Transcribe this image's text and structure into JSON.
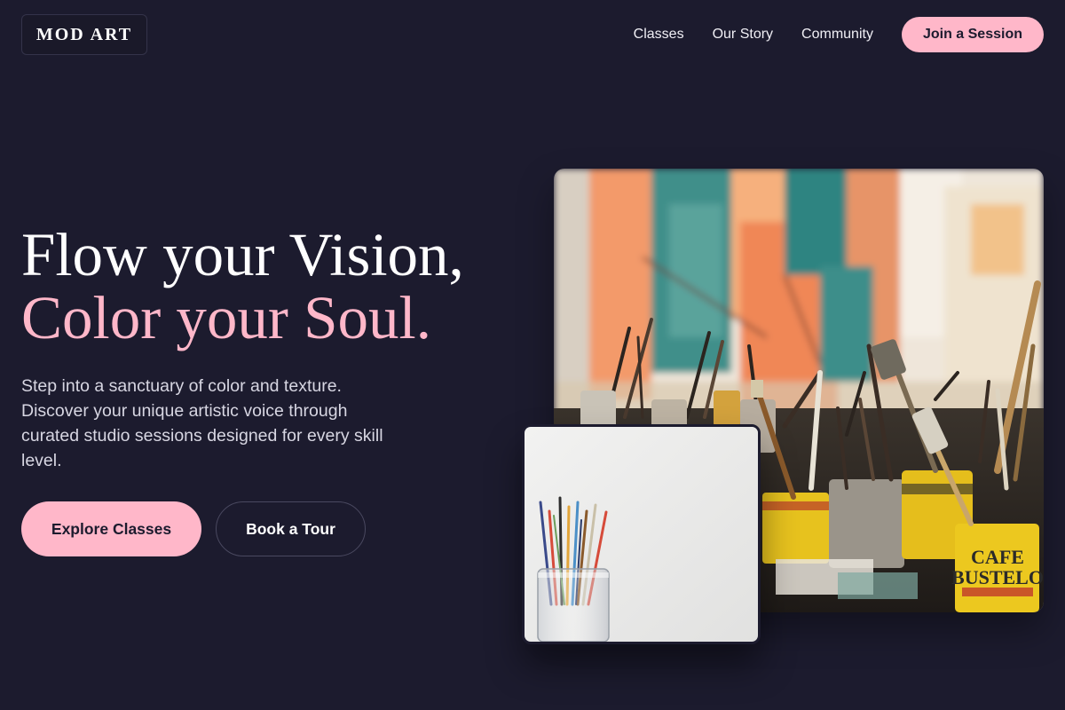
{
  "header": {
    "logo_text": "MOD ART",
    "nav": [
      {
        "label": "Classes"
      },
      {
        "label": "Our Story"
      },
      {
        "label": "Community"
      }
    ],
    "cta_label": "Join a Session"
  },
  "hero": {
    "title_line1": "Flow your Vision,",
    "title_line2": "Color your Soul.",
    "description": "Step into a sanctuary of color and texture. Discover your unique artistic voice through curated studio sessions designed for every skill level.",
    "primary_button": "Explore Classes",
    "secondary_button": "Book a Tour"
  },
  "images": {
    "main": {
      "depicts": "paint-brushes-in-tins-studio-photo"
    },
    "small": {
      "depicts": "brushes-in-glass-jar-photo"
    }
  },
  "colors": {
    "background": "#1c1b2e",
    "accent_pink": "#ffb7c9",
    "text_light": "#d7d6e2"
  }
}
